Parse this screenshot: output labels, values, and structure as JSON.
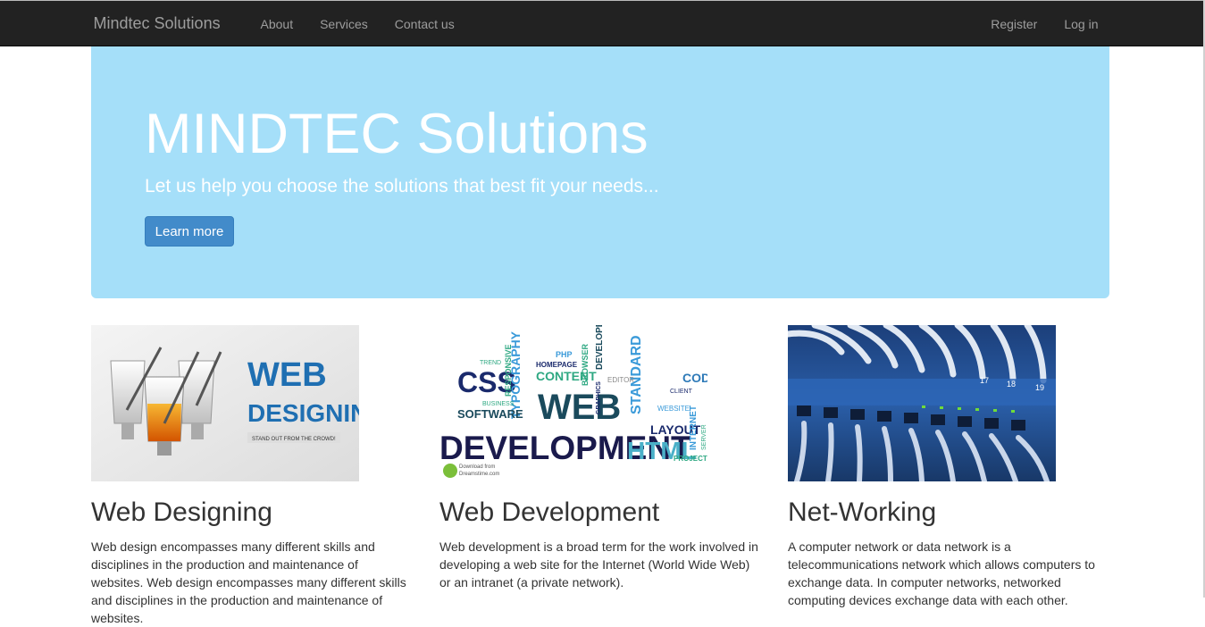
{
  "navbar": {
    "brand": "Mindtec Solutions",
    "left_items": [
      "About",
      "Services",
      "Contact us"
    ],
    "right_items": [
      "Register",
      "Log in"
    ]
  },
  "jumbotron": {
    "title": "MINDTEC Solutions",
    "lead": "Let us help you choose the solutions that best fit your needs...",
    "button_label": "Learn more"
  },
  "columns": [
    {
      "heading": "Web Designing",
      "image_text": [
        "WEB",
        "DESIGNING",
        "STAND OUT FROM THE CROWD!"
      ],
      "text": "Web design encompasses many different skills and disciplines in the production and maintenance of websites. Web design encompasses many different skills and disciplines in the production and maintenance of websites."
    },
    {
      "heading": "Web Development",
      "image_text": [
        "CSS",
        "WEB",
        "DEVELOPMENT",
        "HTML",
        "TYPOGRAPHY",
        "CONTENT",
        "SOFTWARE",
        "STANDARD",
        "LAYOUT",
        "CODE",
        "RESPONSIVE",
        "HOMEPAGE",
        "BROWSER",
        "DEVELOPER",
        "PHP",
        "EDITOR",
        "WEBSITE",
        "PROJECT",
        "INTERNET",
        "SERVER",
        "CLIENT",
        "GRAPHICS",
        "BUSINESS",
        "TREND",
        "Download from",
        "Dreamstime.com"
      ],
      "text": "Web development is a broad term for the work involved in developing a web site for the Internet (World Wide Web) or an intranet (a private network)."
    },
    {
      "heading": "Net-Working",
      "image_text": [
        "17",
        "18",
        "19"
      ],
      "text": "A computer network or data network is a telecommunications network which allows computers to exchange data. In computer networks, networked computing devices exchange data with each other."
    }
  ],
  "colors": {
    "navbar_bg": "#222222",
    "jumbotron_bg": "#a5dff9",
    "button_bg": "#428bca"
  }
}
